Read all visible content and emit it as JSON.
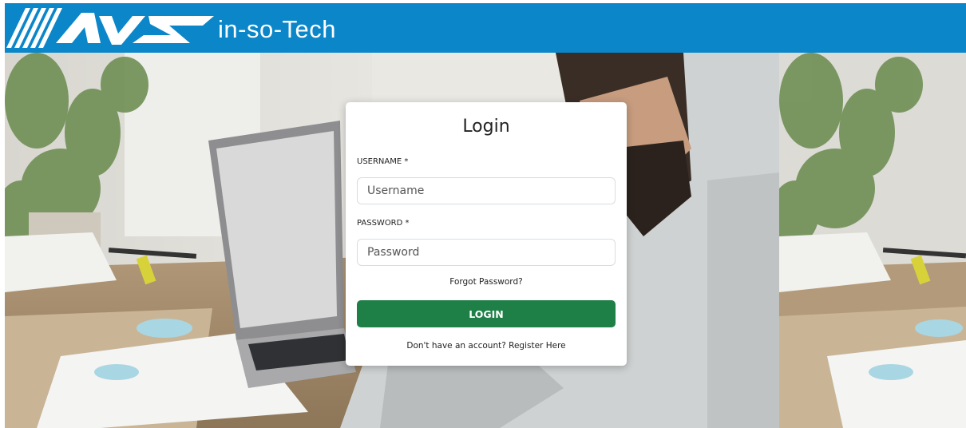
{
  "header": {
    "brand_text": "in-so-Tech",
    "logo_icon": "avs-logo-icon",
    "background_color": "#0a86c9"
  },
  "login": {
    "title": "Login",
    "username_label": "USERNAME *",
    "username_placeholder": "Username",
    "username_value": "",
    "password_label": "PASSWORD *",
    "password_placeholder": "Password",
    "password_value": "",
    "forgot_link": "Forgot Password?",
    "login_button": "LOGIN",
    "register_prompt": "Don't have an account?",
    "register_link": "Register Here",
    "button_color": "#1e7f47"
  }
}
